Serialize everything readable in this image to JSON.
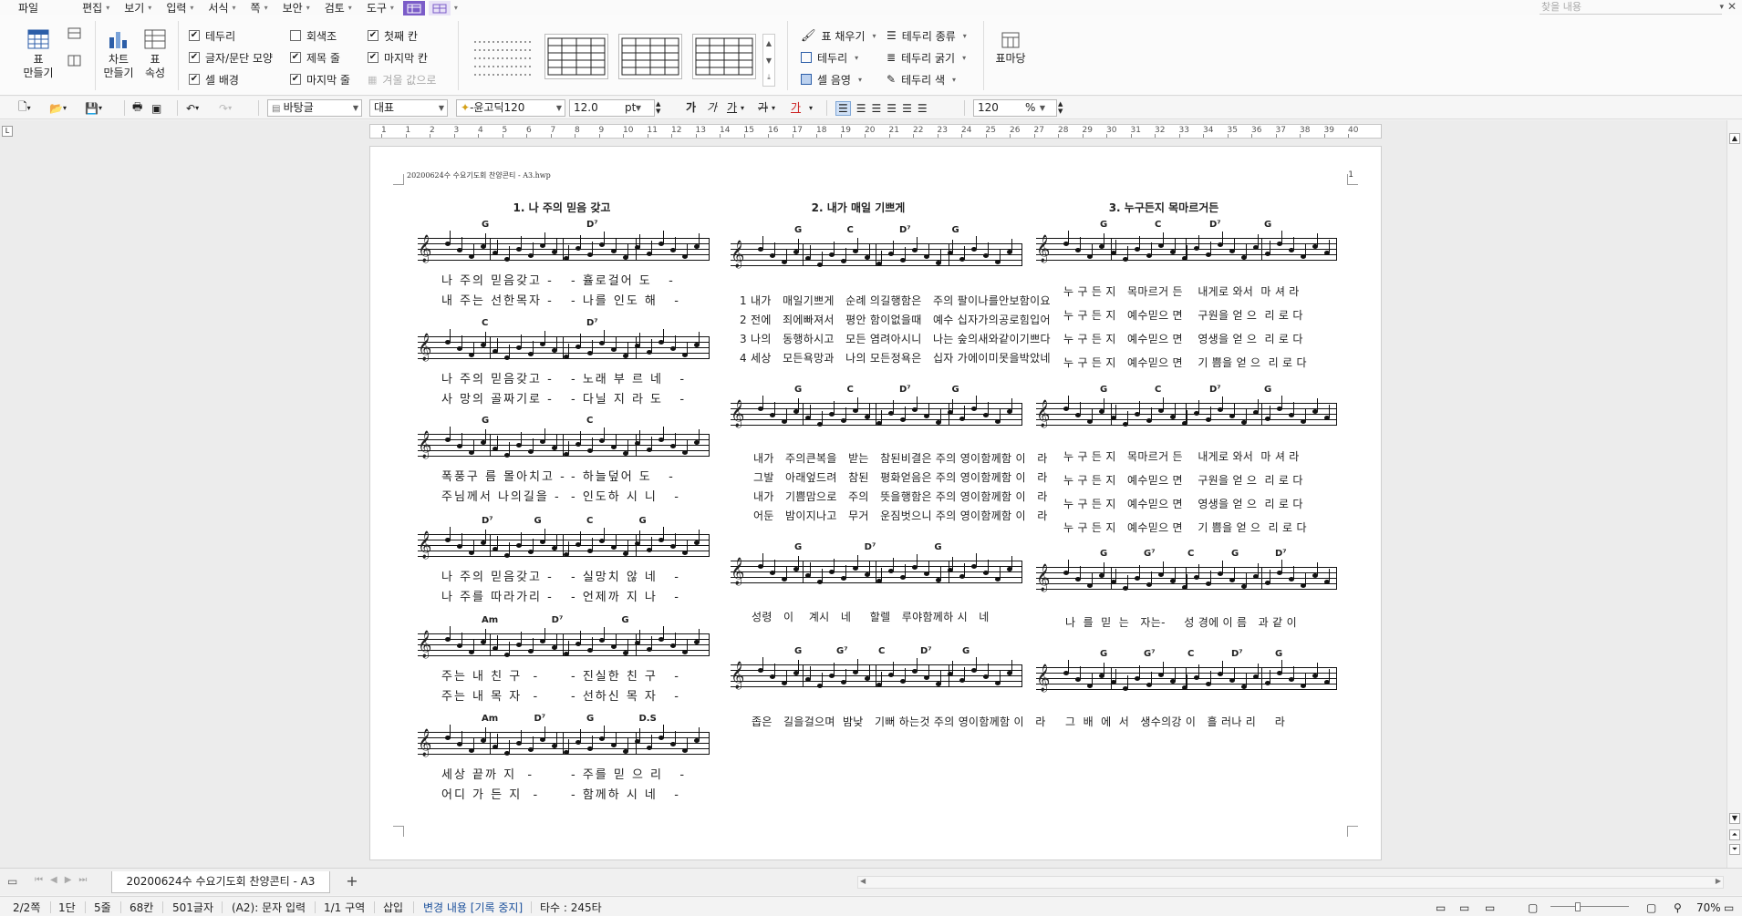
{
  "menubar": {
    "items": [
      {
        "label": "파일"
      },
      {
        "label": "편집"
      },
      {
        "label": "보기"
      },
      {
        "label": "입력"
      },
      {
        "label": "서식"
      },
      {
        "label": "쪽"
      },
      {
        "label": "보안"
      },
      {
        "label": "검토"
      },
      {
        "label": "도구"
      }
    ],
    "search_placeholder": "찾을 내용"
  },
  "ribbon": {
    "make_table": "표\n만들기",
    "make_chart": "차트\n만들기",
    "table_props": "표\n속성",
    "checks_col1": [
      {
        "label": "테두리",
        "checked": true
      },
      {
        "label": "글자/문단 모양",
        "checked": true
      },
      {
        "label": "셀 배경",
        "checked": true
      }
    ],
    "checks_col2": [
      {
        "label": "회색조",
        "checked": false
      },
      {
        "label": "제목 줄",
        "checked": true
      },
      {
        "label": "마지막 줄",
        "checked": true
      }
    ],
    "checks_col3": [
      {
        "label": "첫째 칸",
        "checked": true
      },
      {
        "label": "마지막 칸",
        "checked": true
      },
      {
        "label": "겨울 값으로",
        "checked": false,
        "disabled": true
      }
    ],
    "cmds_left": [
      {
        "label": "표 채우기",
        "icon": "fill-icon"
      },
      {
        "label": "테두리",
        "icon": "border-icon"
      },
      {
        "label": "셀 음영",
        "icon": "shade-icon"
      }
    ],
    "cmds_right": [
      {
        "label": "테두리 종류",
        "icon": "line-type-icon"
      },
      {
        "label": "테두리 굵기",
        "icon": "line-weight-icon"
      },
      {
        "label": "테두리 색",
        "icon": "pen-icon"
      }
    ],
    "table_margin": "표마당"
  },
  "toolbar": {
    "style": "바탕글",
    "lang": "대표",
    "font": "-윤고딕120",
    "size": "12.0",
    "size_unit": "pt",
    "zoom": "120",
    "zoom_unit": "%",
    "fmt_bold": "가",
    "fmt_italic": "가",
    "fmt_underline": "가",
    "fmt_strike": "가",
    "fmt_color": "가"
  },
  "ruler": {
    "labels": [
      "1",
      "1",
      "2",
      "3",
      "4",
      "5",
      "6",
      "7",
      "8",
      "9",
      "10",
      "11",
      "12",
      "13",
      "14",
      "15",
      "16",
      "17",
      "18",
      "19",
      "20",
      "21",
      "22",
      "23",
      "24",
      "25",
      "26",
      "27",
      "28",
      "29",
      "30",
      "31",
      "32",
      "33",
      "34",
      "35",
      "36",
      "37",
      "38",
      "39",
      "40"
    ]
  },
  "document": {
    "header_file": "20200624수 수요기도회 찬양콘티 - A3.hwp",
    "page_number": "1",
    "songs": [
      {
        "title": "1. 나 주의 믿음 갖고",
        "chords": [
          [
            "G",
            "D⁷"
          ],
          [
            "C",
            "D⁷"
          ],
          [
            "G",
            "C"
          ],
          [
            "D⁷",
            "G",
            "C",
            "G"
          ],
          [
            "Am",
            "D⁷",
            "G"
          ],
          [
            "Am",
            "D⁷",
            "G",
            "D.S"
          ]
        ],
        "lyrics": [
          [
            "나 주의 믿음갖고 -",
            "- 휼로걸어 도   -"
          ],
          [
            "내 주는 선한목자 -",
            "- 나를 인도 해   -"
          ],
          [
            "나 주의 믿음갖고 -",
            "- 노래 부 르 네   -"
          ],
          [
            "사 망의 골짜기로 -",
            "- 다닐 지 라 도   -"
          ],
          [
            "폭풍구 름 몰아치고 -",
            "- 하늘덮어 도   -"
          ],
          [
            "주님께서 나의길을 -",
            "- 인도하 시 니   -"
          ],
          [
            "나 주의 믿음갖고 -",
            "- 실망치 않 네   -"
          ],
          [
            "나 주를 따라가리 -",
            "- 언제까 지 나   -"
          ],
          [
            "주는 내 친 구  -",
            "- 진실한 친 구   -"
          ],
          [
            "주는 내 목 자  -",
            "- 선하신 목 자   -"
          ],
          [
            "세상 끝까 지  -",
            "- 주를 믿 으 리   -"
          ],
          [
            "어디 가 든 지  -",
            "- 함께하 시 네   -"
          ]
        ]
      },
      {
        "title": "2. 내가 매일 기쁘게",
        "chords": [
          [
            "G",
            "C",
            "D⁷",
            "G"
          ],
          [
            "G",
            "C",
            "D⁷",
            "G"
          ],
          [
            "G",
            "D⁷",
            "G"
          ],
          [
            "G",
            "G⁷",
            "C",
            "D⁷",
            "G"
          ]
        ],
        "verses": [
          "1 내가   매일기쁘게   순례 의길행함은   주의 팔이나를안보함이요",
          "2 전에   죄에빠져서   평안 함이없을때   예수 십자가의공로힘입어",
          "3 나의   동행하시고   모든 염려아시니   나는 숲의새와같이기쁘다",
          "4 세상   모든욕망과   나의 모든정욕은   십자 가에이미못을박았네"
        ],
        "refrain": [
          "내가   주의큰복을   받는   참된비결은 주의 영이함께함 이   라",
          "그발   아래엎드려   참된   평화얻음은 주의 영이함께함 이   라",
          "내가   기쁨맘으로   주의   뜻을행함은 주의 영이함께함 이   라",
          "어둔   밤이지나고   무거   운짐벗으니 주의 영이함께함 이   라"
        ],
        "refrain2": "성령   이    계시   네     할렐   루야함께하 시   네",
        "refrain3": "좁은   길을걸으며  밤낮   기뻐 하는것 주의 영이함께함 이   라"
      },
      {
        "title": "3. 누구든지 목마르거든",
        "chords": [
          [
            "G",
            "C",
            "D⁷",
            "G"
          ],
          [
            "G",
            "C",
            "D⁷",
            "G"
          ],
          [
            "G",
            "G⁷",
            "C",
            "G",
            "D⁷"
          ],
          [
            "G",
            "G⁷",
            "C",
            "D⁷",
            "G"
          ]
        ],
        "lyrics_a": [
          "누 구 든 지   목마르거 든    내게로 와서  마 셔 라",
          "누 구 든 지   예수믿으 면    구원을 얻 으  리 로 다",
          "누 구 든 지   예수믿으 면    영생을 얻 으  리 로 다",
          "누 구 든 지   예수믿으 면    기 쁨을 얻 으  리 로 다"
        ],
        "lyrics_b": [
          "누 구 든 지   목마르거 든    내게로 와서  마 셔 라",
          "누 구 든 지   예수믿으 면    구원을 얻 으  리 로 다",
          "누 구 든 지   예수믿으 면    영생을 얻 으  리 로 다",
          "누 구 든 지   예수믿으 면    기 쁨을 얻 으  리 로 다"
        ],
        "lyrics_c": "나  를  믿  는   자는-     성 경에 이 름   과 같 이",
        "lyrics_d": "그  배  에  서   생수의강 이   흘 러나 리     라"
      }
    ]
  },
  "tabbar": {
    "doc_tab": "20200624수 수요기도회 찬양콘티 - A3"
  },
  "statusbar": {
    "page": "2/2쪽",
    "section": "1단",
    "line": "5줄",
    "column": "68칸",
    "chars": "501글자",
    "cell": "(A2): 문자 입력",
    "zone": "1/1 구역",
    "insert": "삽입",
    "track": "변경 내용 [기록 중지]",
    "keystrokes": "타수 : 245타",
    "zoom": "70%"
  },
  "colors": {
    "accent": "#7b5cc8",
    "track_text": "#1a4f9b"
  }
}
